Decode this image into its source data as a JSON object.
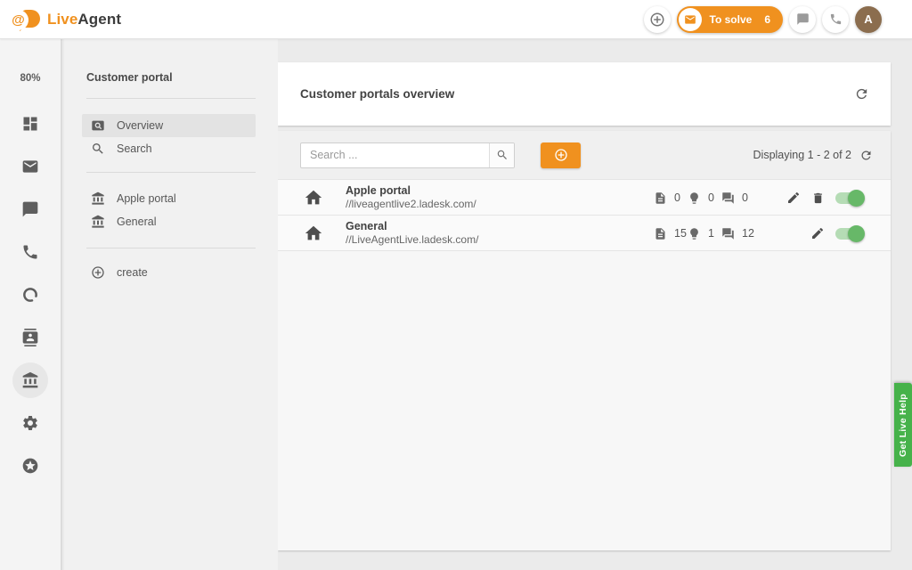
{
  "brand": {
    "live": "Live",
    "agent": "Agent"
  },
  "header": {
    "to_solve_label": "To solve",
    "to_solve_count": "6",
    "avatar_initial": "A",
    "icons": [
      "add-circle-icon",
      "envelope-icon",
      "chat-icon",
      "phone-icon"
    ]
  },
  "rail": {
    "usage": "80%",
    "items": [
      {
        "icon": "dashboard-icon",
        "active": false
      },
      {
        "icon": "mail-icon",
        "active": false
      },
      {
        "icon": "chat-icon",
        "active": false
      },
      {
        "icon": "phone-icon",
        "active": false
      },
      {
        "icon": "ring-icon",
        "active": false
      },
      {
        "icon": "contacts-icon",
        "active": false
      },
      {
        "icon": "portal-icon",
        "active": true
      },
      {
        "icon": "settings-icon",
        "active": false
      },
      {
        "icon": "addons-icon",
        "active": false
      }
    ]
  },
  "panel": {
    "title": "Customer portal",
    "items": [
      {
        "label": "Overview",
        "icon": "overview-icon",
        "active": true
      },
      {
        "label": "Search",
        "icon": "search-icon",
        "active": false
      }
    ],
    "portals": [
      {
        "label": "Apple portal",
        "icon": "bank-icon"
      },
      {
        "label": "General",
        "icon": "bank-icon"
      }
    ],
    "create_label": "create",
    "create_icon": "add-circle-outline-icon"
  },
  "main": {
    "title": "Customer portals overview",
    "toolbar": {
      "search_placeholder": "Search ...",
      "add_icon": "add-circle-outline-icon",
      "displaying": "Displaying 1 - 2 of 2",
      "refresh_icon": "refresh-icon"
    },
    "rows": [
      {
        "name": "Apple portal",
        "url": "//liveagentlive2.ladesk.com/",
        "articles": "0",
        "suggestions": "0",
        "forum_posts": "0",
        "toggle_on": true
      },
      {
        "name": "General",
        "url": "//LiveAgentLive.ladesk.com/",
        "articles": "15",
        "suggestions": "1",
        "forum_posts": "12",
        "toggle_on": true
      }
    ]
  },
  "help_tab": {
    "label": "Get Live Help"
  },
  "colors": {
    "accent_orange": "#f0911f",
    "toggle_green": "#67b868",
    "toggle_track_green": "#b5dcb5",
    "help_green": "#46b24a",
    "avatar_brown": "#8b6d4e"
  }
}
